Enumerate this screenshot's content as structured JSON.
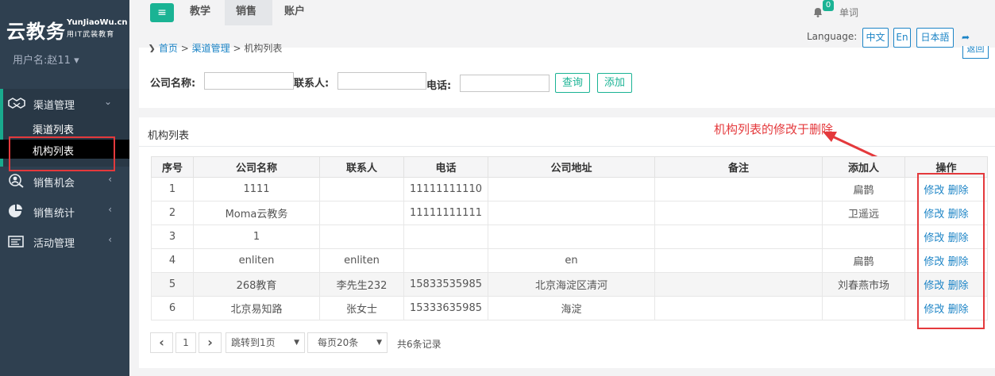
{
  "logo": {
    "main": "云教务",
    "en": "YunJiaoWu.cn",
    "sub": "用IT武装教育"
  },
  "user": {
    "label": "用户名:赵11"
  },
  "sidebar": {
    "channel": {
      "label": "渠道管理",
      "sub": [
        "渠道列表",
        "机构列表"
      ]
    },
    "items": [
      {
        "label": "销售机会"
      },
      {
        "label": "销售统计"
      },
      {
        "label": "活动管理"
      }
    ]
  },
  "topnav": {
    "tabs": [
      "教学",
      "销售",
      "账户"
    ],
    "active": "销售",
    "badge": "0",
    "word": "单词"
  },
  "language": {
    "label": "Language:",
    "zh": "中文",
    "en": "En",
    "ja": "日本語"
  },
  "back_label": "返回",
  "breadcrumb": {
    "home": "首页",
    "sep": ">",
    "mid": "渠道管理",
    "current": "机构列表"
  },
  "filters": {
    "company_label": "公司名称:",
    "contact_label": "联系人:",
    "phone_label": "电话:",
    "query_btn": "查询",
    "add_btn": "添加"
  },
  "list": {
    "title": "机构列表",
    "annotation": "机构列表的修改于删除",
    "headers": [
      "序号",
      "公司名称",
      "联系人",
      "电话",
      "公司地址",
      "备注",
      "添加人",
      "操作"
    ],
    "edit_label": "修改",
    "delete_label": "删除",
    "rows": [
      [
        "1",
        "1111",
        "",
        "11111111110",
        "",
        "",
        "扁鹊"
      ],
      [
        "2",
        "Moma云教务",
        "",
        "11111111111",
        "",
        "",
        "卫遥远"
      ],
      [
        "3",
        "1",
        "",
        "",
        "",
        "",
        ""
      ],
      [
        "4",
        "enliten",
        "enliten",
        "",
        "en",
        "",
        "扁鹊"
      ],
      [
        "5",
        "268教育",
        "李先生232",
        "15833535985",
        "北京海淀区清河",
        "",
        "刘春燕市场"
      ],
      [
        "6",
        "北京易知路",
        "张女士",
        "15333635985",
        "海淀",
        "",
        ""
      ]
    ]
  },
  "pagination": {
    "prev": "‹",
    "page": "1",
    "next": "›",
    "jump": "跳转到1页",
    "per_page": "每页20条",
    "total": "共6条记录"
  },
  "colors": {
    "sidebar": "#2f4050",
    "accent": "#1ab394",
    "link": "#1c84c6",
    "annotation": "#e4393c"
  }
}
